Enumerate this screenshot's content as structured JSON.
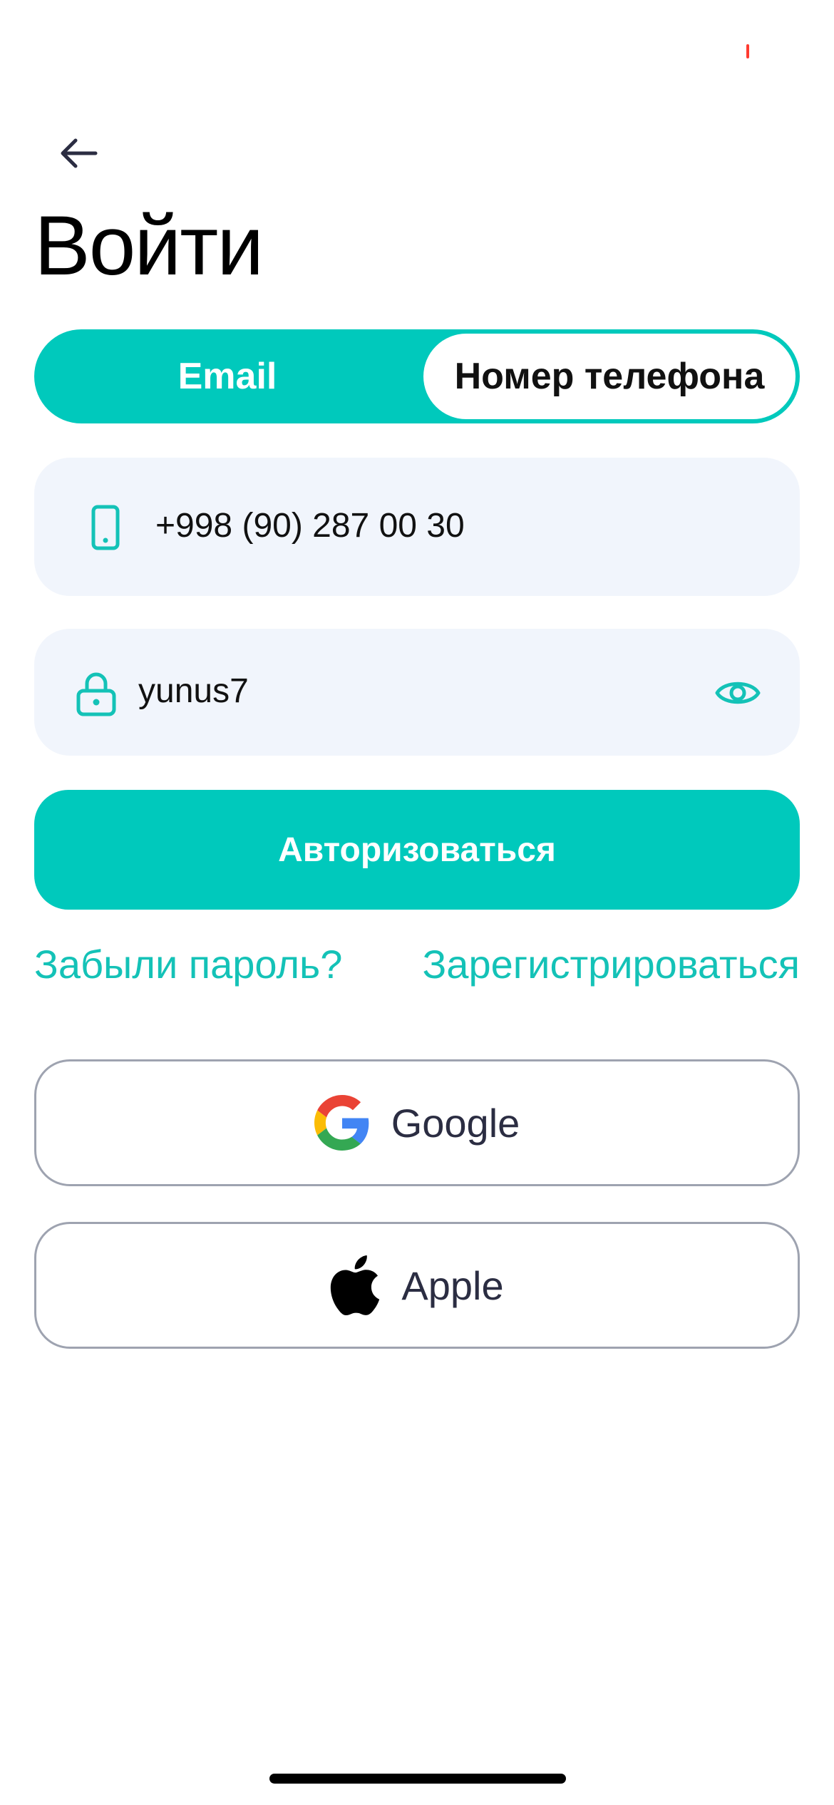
{
  "header": {
    "title": "Войти"
  },
  "login_method": {
    "options": [
      {
        "label": "Email",
        "selected": false
      },
      {
        "label": "Номер телефона",
        "selected": true
      }
    ]
  },
  "form": {
    "phone_value": "+998 (90) 287 00 30",
    "password_value": "yunus7",
    "submit_label": "Авторизоваться"
  },
  "links": {
    "forgot_password": "Забыли пароль?",
    "register": "Зарегистрироваться"
  },
  "social": {
    "google_label": "Google",
    "apple_label": "Apple"
  },
  "colors": {
    "accent": "#00c9bc",
    "link": "#14c2b7",
    "field_background": "#f1f5fc",
    "border": "#9ea3b0"
  },
  "icons": [
    "back-arrow-icon",
    "phone-icon",
    "lock-icon",
    "eye-icon",
    "google-logo-icon",
    "apple-logo-icon"
  ]
}
